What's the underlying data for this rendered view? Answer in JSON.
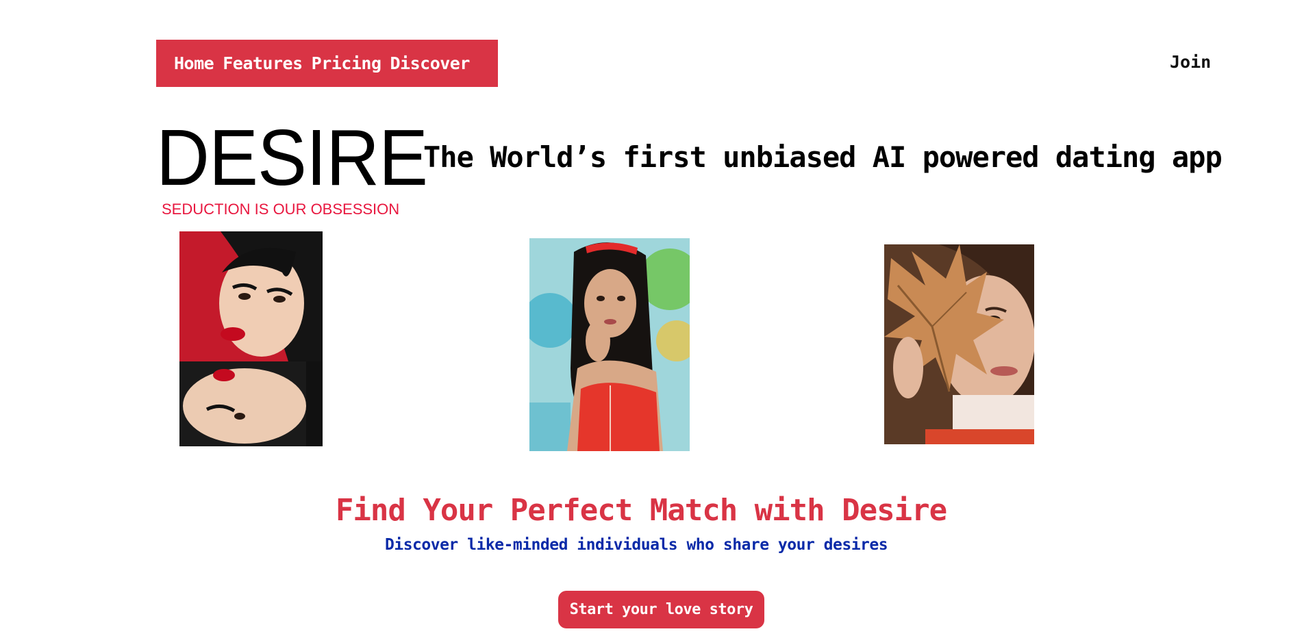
{
  "nav": {
    "links": [
      "Home",
      "Features",
      "Pricing",
      "Discover"
    ],
    "join_label": "Join"
  },
  "brand": {
    "logo": "DESIRE",
    "tagline": "SEDUCTION IS OUR OBSESSION"
  },
  "headline": "The World’s first unbiased AI powered dating app",
  "gallery": [
    {
      "name": "photo-two-women-red-lipstick"
    },
    {
      "name": "photo-woman-red-top"
    },
    {
      "name": "photo-woman-autumn-leaf"
    }
  ],
  "hero": {
    "title": "Find Your Perfect Match with Desire",
    "subtitle": "Discover like-minded individuals who share your desires",
    "cta_label": "Start your love story"
  },
  "colors": {
    "accent": "#d93445",
    "tagline": "#e8173f",
    "subtitle": "#0a2aa8"
  }
}
